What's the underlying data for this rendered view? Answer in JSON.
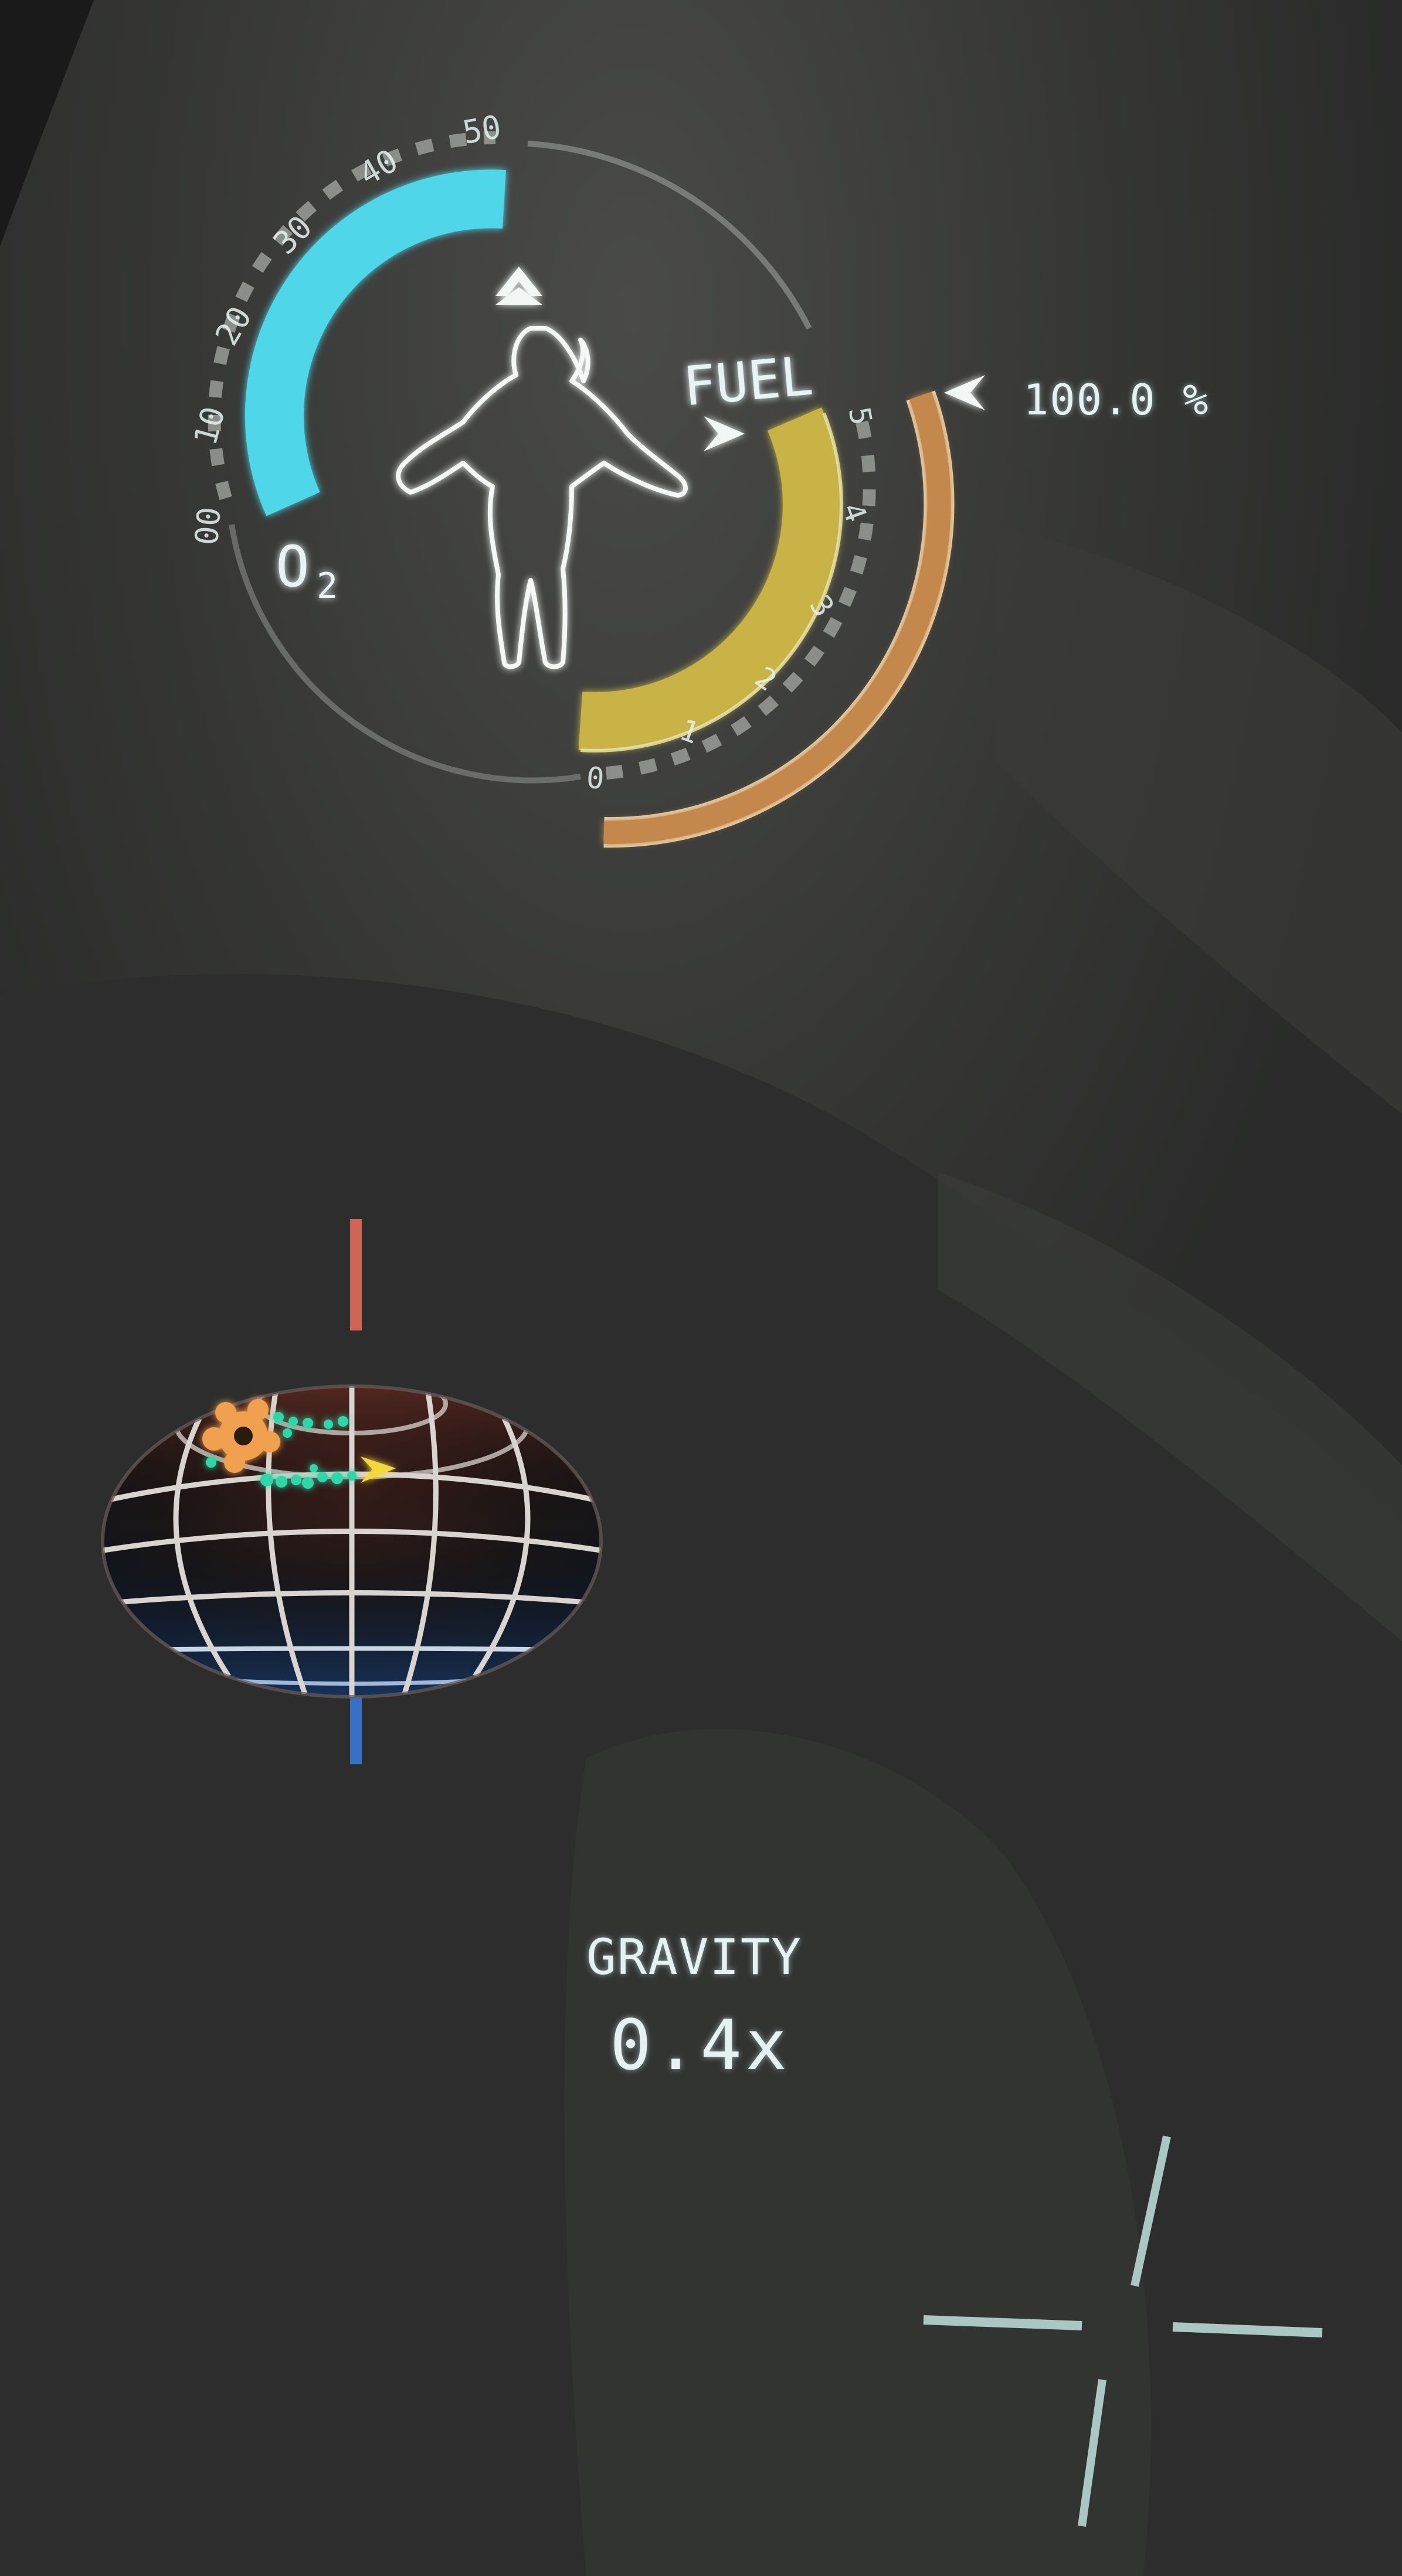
{
  "hud": {
    "suit_status": {
      "oxygen": {
        "label": "O",
        "label_subscript": "2",
        "scale_ticks": [
          "00",
          "10",
          "20",
          "30",
          "40",
          "50"
        ],
        "level_fraction": 0.5,
        "color": "#4fd6e8"
      },
      "fuel": {
        "label": "FUEL",
        "scale_ticks": [
          "0",
          "1",
          "2",
          "3",
          "4",
          "5"
        ],
        "level_fraction": 1.0,
        "color": "#c9b347"
      },
      "outer_reserve": {
        "color": "#c4884e",
        "readout": "100.0 %"
      }
    },
    "gravity": {
      "title": "GRAVITY",
      "value": "0.4x"
    },
    "locator": {
      "north_axis_color": "#e26a5a",
      "south_axis_color": "#3a78d8",
      "sun_color": "#f0a050",
      "cluster_color": "#2fd6a8",
      "player_marker_color": "#f4d83a"
    },
    "crosshair": {
      "color": "#b8d8d4"
    }
  }
}
